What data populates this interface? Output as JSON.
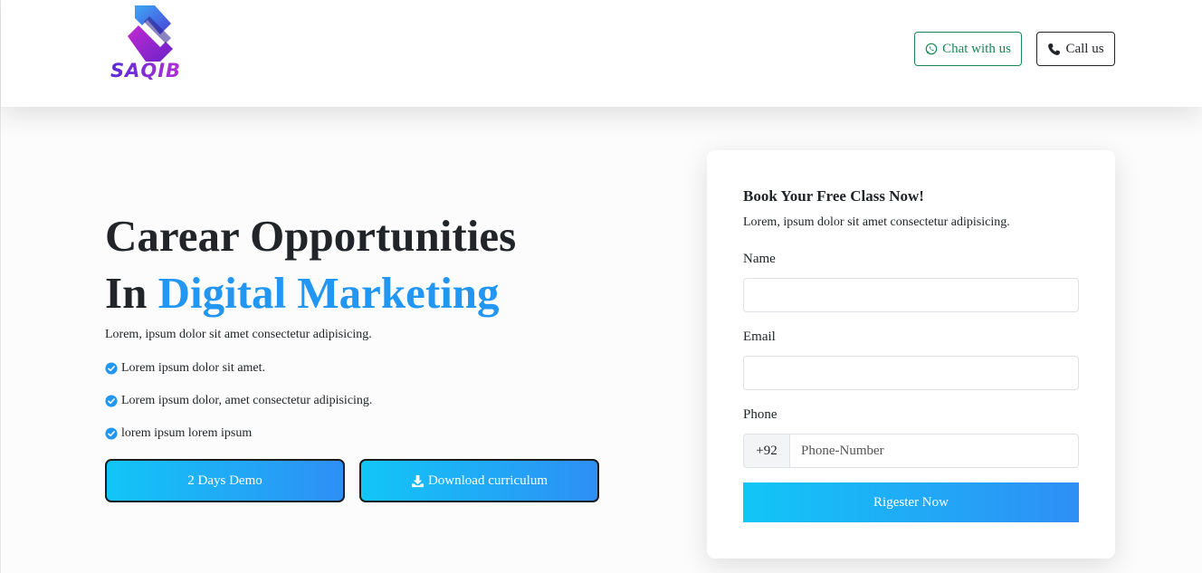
{
  "header": {
    "logo_text": "SAQIB",
    "chat_label": "Chat with us",
    "call_label": "Call us"
  },
  "hero": {
    "title_line1": "Carear Opportunities",
    "title_line2_prefix": "In ",
    "title_line2_accent": "Digital Marketing",
    "subtitle": "Lorem, ipsum dolor sit amet consectetur adipisicing.",
    "bullets": [
      "Lorem ipsum dolor sit amet.",
      "Lorem ipsum dolor, amet consectetur adipisicing.",
      "lorem ipsum lorem ipsum"
    ],
    "demo_button": "2 Days Demo",
    "download_button": "Download curriculum"
  },
  "form": {
    "title": "Book Your Free Class Now!",
    "subtitle": "Lorem, ipsum dolor sit amet consectetur adipisicing.",
    "name_label": "Name",
    "name_value": "",
    "email_label": "Email",
    "email_value": "",
    "phone_label": "Phone",
    "phone_prefix": "+92",
    "phone_placeholder": "Phone-Number",
    "submit_label": "Rigester Now"
  },
  "colors": {
    "accent": "#2196f3",
    "gradient_start": "#12c6f7",
    "gradient_end": "#2e8ff5",
    "chat_green": "#198754"
  },
  "icons": [
    "logo-icon",
    "whatsapp-icon",
    "phone-icon",
    "check-circle-icon",
    "download-icon"
  ]
}
